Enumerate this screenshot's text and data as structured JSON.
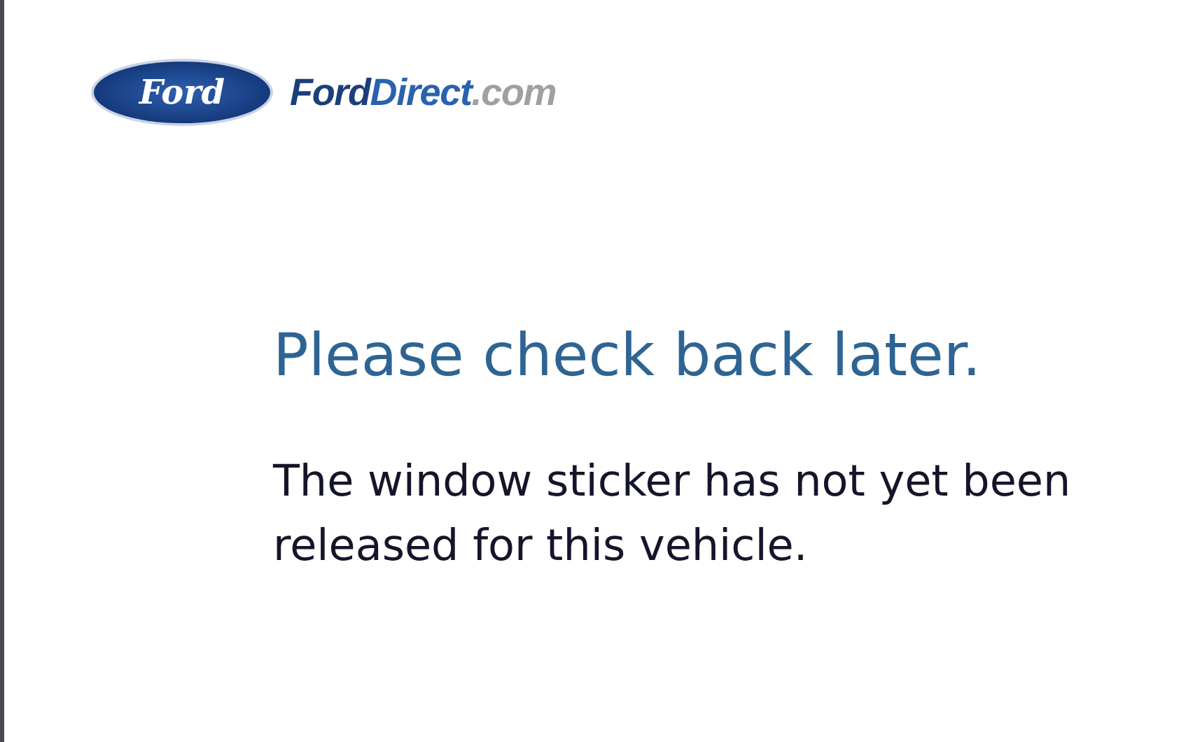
{
  "logo": {
    "oval_text": "Ford",
    "brand_parts": [
      "Ford",
      "Direct",
      ".com"
    ]
  },
  "heading": "Please check back later.",
  "message": "The window sticker has not yet been released for this vehicle."
}
